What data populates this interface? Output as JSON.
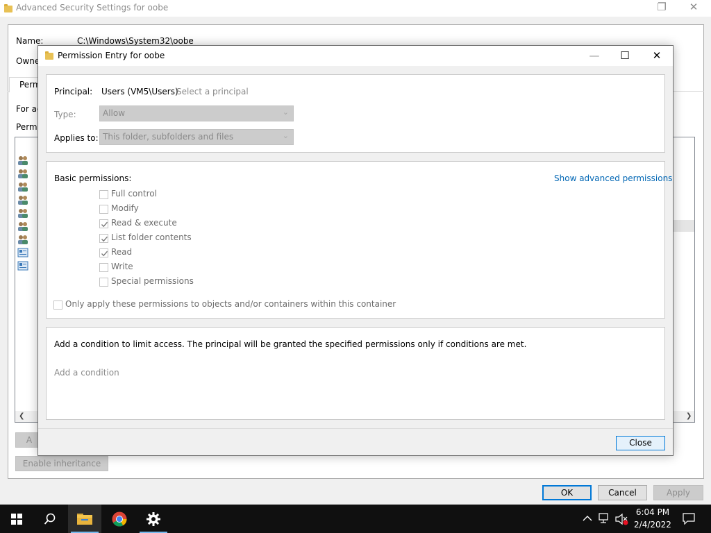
{
  "background_window": {
    "title": "Advanced Security Settings for oobe",
    "name_label": "Name:",
    "name_value": "C:\\Windows\\System32\\oobe",
    "owner_label_partial": "Owne",
    "tab_partial": "Perm",
    "for_additional_partial": "For ac",
    "permission_entries_partial": "Permi",
    "enable_inheritance_label": "Enable inheritance",
    "add_button_partial": "A",
    "ok_label": "OK",
    "cancel_label": "Cancel",
    "apply_label": "Apply"
  },
  "dialog": {
    "title": "Permission Entry for oobe",
    "principal_label": "Principal:",
    "principal_value": "Users (VM5\\Users)",
    "select_principal_link": "Select a principal",
    "type_label": "Type:",
    "type_value": "Allow",
    "applies_to_label": "Applies to:",
    "applies_to_value": "This folder, subfolders and files",
    "basic_permissions_label": "Basic permissions:",
    "show_advanced_link": "Show advanced permissions",
    "permissions": [
      {
        "label": "Full control",
        "checked": false
      },
      {
        "label": "Modify",
        "checked": false
      },
      {
        "label": "Read & execute",
        "checked": true
      },
      {
        "label": "List folder contents",
        "checked": true
      },
      {
        "label": "Read",
        "checked": true
      },
      {
        "label": "Write",
        "checked": false
      },
      {
        "label": "Special permissions",
        "checked": false
      }
    ],
    "only_apply_label": "Only apply these permissions to objects and/or containers within this container",
    "condition_text": "Add a condition to limit access. The principal will be granted the specified permissions only if conditions are met.",
    "add_condition_link": "Add a condition",
    "close_label": "Close"
  },
  "taskbar": {
    "apps": [
      {
        "name": "start",
        "icon": "windows-logo-icon"
      },
      {
        "name": "search",
        "icon": "search-icon"
      },
      {
        "name": "file-explorer",
        "icon": "folder-icon",
        "active": true
      },
      {
        "name": "chrome",
        "icon": "chrome-icon"
      },
      {
        "name": "settings",
        "icon": "gear-icon"
      }
    ],
    "time": "6:04 PM",
    "date": "2/4/2022"
  },
  "colors": {
    "accent": "#0078d7",
    "link": "#0066b4",
    "taskbar": "#101010"
  }
}
